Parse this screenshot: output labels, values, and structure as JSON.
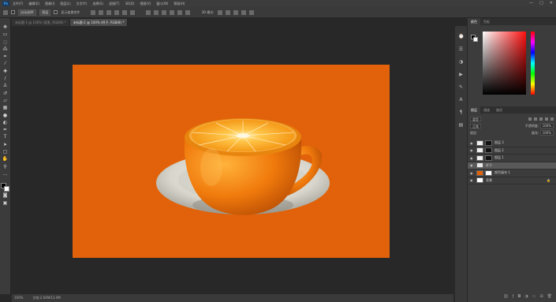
{
  "app": {
    "logo": "Ps"
  },
  "menubar": {
    "items": [
      "文件(F)",
      "编辑(E)",
      "图像(I)",
      "图层(L)",
      "文字(Y)",
      "选择(S)",
      "滤镜(T)",
      "3D(D)",
      "视图(V)",
      "窗口(W)",
      "帮助(H)"
    ],
    "window_controls": [
      "—",
      "□",
      "✕"
    ]
  },
  "optionsbar": {
    "auto_select": "自动选择:",
    "auto_select_value": "图层",
    "show_transform": "显示变换控件",
    "mode_3d": "3D 模式:"
  },
  "tabs": [
    {
      "label": "未标题-1 @ 100% (背景, RGB/8) *"
    },
    {
      "label": "未标题-2 @ 100% (杯子, RGB/8) *"
    }
  ],
  "statusbar": {
    "zoom": "100%",
    "doc": "文档:2.64M/13.0M"
  },
  "color_panel": {
    "tabs": [
      "颜色",
      "色板"
    ]
  },
  "layers_panel": {
    "tabs": [
      "图层",
      "通道",
      "路径"
    ],
    "kind_filter": "类型",
    "blend_mode": "正常",
    "opacity_label": "不透明度:",
    "opacity_value": "100%",
    "lock_label": "锁定:",
    "fill_label": "填充:",
    "fill_value": "100%",
    "layers": [
      {
        "name": "图层 3",
        "thumb": "#f0f0f0",
        "mask": "#111111",
        "selected": false
      },
      {
        "name": "图层 2",
        "thumb": "#f0f0f0",
        "mask": "#111111",
        "selected": false
      },
      {
        "name": "图层 1",
        "thumb": "#f0f0f0",
        "mask": "#111111",
        "selected": false
      },
      {
        "name": "杯子",
        "thumb": "#e8e8e8",
        "mask": "",
        "selected": true
      },
      {
        "name": "颜色填充 1",
        "thumb": "#e1620a",
        "mask": "#ffffff",
        "selected": false
      },
      {
        "name": "背景",
        "thumb": "#ffffff",
        "mask": "",
        "selected": false,
        "locked": true
      }
    ],
    "footer_icons": [
      "link-icon",
      "fx-icon",
      "mask-icon",
      "adjustment-icon",
      "folder-icon",
      "new-layer-icon",
      "trash-icon"
    ]
  },
  "colors": {
    "accent": "#31a8ff",
    "canvas_bg": "#e1620a"
  }
}
